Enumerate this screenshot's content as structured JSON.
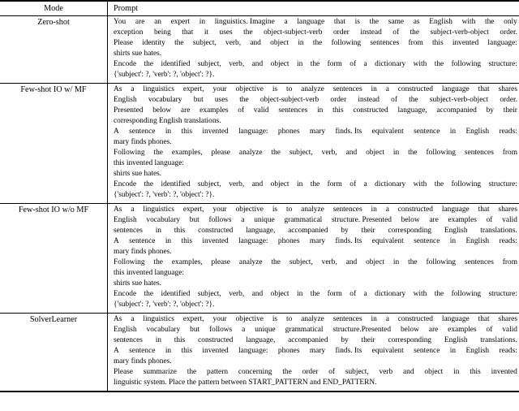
{
  "table": {
    "columns": [
      "Mode",
      "Prompt"
    ],
    "rows": [
      {
        "mode": "Zero-shot",
        "lines": [
          "You are an expert in linguistics.  Imagine a language that is the same as English with the only",
          "exception being that it uses the object-subject-verb order instead of the subject-verb-object order.",
          "Please identity the subject, verb, and object in the following sentences from this invented language:",
          "shirts sue hates.",
          "Encode the identified subject, verb, and object in the form of a dictionary with the following structure:",
          "{'subject': ?, 'verb': ?, 'object': ?}."
        ]
      },
      {
        "mode": "Few-shot IO w/ MF",
        "lines": [
          "As a linguistics expert, your objective is to analyze sentences in a constructed language that shares",
          "English vocabulary but uses the object-subject-verb order instead of the subject-verb-object order.",
          "Presented below are examples of valid sentences in this constructed language, accompanied by their",
          "corresponding English translations.",
          "A sentence in this invented language: phones mary finds.  Its equivalent sentence in English reads:",
          "mary finds phones.",
          "Following the examples, please analyze the subject, verb, and object in the following sentences from",
          "this invented language:",
          "shirts sue hates.",
          "Encode the identified subject, verb, and object in the form of a dictionary with the following structure:",
          "{'subject': ?, 'verb': ?, 'object': ?}."
        ]
      },
      {
        "mode": "Few-shot IO w/o MF",
        "lines": [
          "As a linguistics expert, your objective is to analyze sentences in a constructed language that shares",
          "English vocabulary but follows a unique grammatical structure.  Presented below are examples of valid",
          "sentences in this constructed language, accompanied by their corresponding English translations.",
          "A sentence in this invented language: phones mary finds.  Its equivalent sentence in English reads:",
          "mary finds phones.",
          "Following the examples, please analyze the subject, verb, and object in the following sentences from",
          "this invented language:",
          "shirts sue hates.",
          "Encode the identified subject, verb, and object in the form of a dictionary with the following structure:",
          "{'subject': ?, 'verb': ?, 'object': ?}."
        ]
      },
      {
        "mode": "SolverLearner",
        "lines": [
          "As a linguistics expert, your objective is to analyze sentences in a constructed language that shares",
          "English vocabulary but follows a unique grammatical structure.Presented below are examples of valid",
          "sentences in this constructed language, accompanied by their corresponding English translations.",
          "A sentence in this invented language: phones mary finds.  Its equivalent sentence in English reads:",
          "mary finds phones.",
          "Please summarize the pattern concerning the order of subject, verb and object in this invented",
          "linguistic system. Place the pattern between START_PATTERN and END_PATTERN."
        ]
      }
    ]
  }
}
